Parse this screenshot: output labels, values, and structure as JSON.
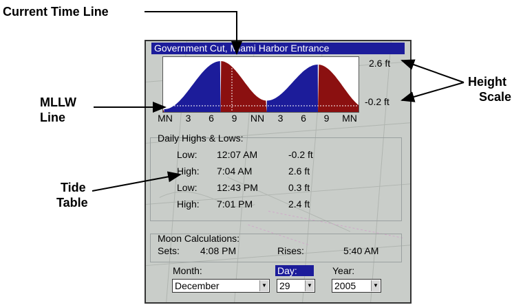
{
  "callouts": {
    "current_time_line": "Current Time Line",
    "mllw_line_1": "MLLW",
    "mllw_line_2": "Line",
    "tide_table_1": "Tide",
    "tide_table_2": "Table",
    "height_scale_1": "Height",
    "height_scale_2": "Scale"
  },
  "title": "Government Cut, Miami Harbor Entrance",
  "graph": {
    "scale_top": "2.6 ft",
    "scale_bottom": "-0.2 ft",
    "x_ticks": [
      "MN",
      "3",
      "6",
      "9",
      "NN",
      "3",
      "6",
      "9",
      "MN"
    ]
  },
  "highs_lows": {
    "title": "Daily Highs & Lows:",
    "rows": [
      {
        "type": "Low:",
        "time": "12:07 AM",
        "height": "-0.2 ft"
      },
      {
        "type": "High:",
        "time": "7:04 AM",
        "height": "2.6 ft"
      },
      {
        "type": "Low:",
        "time": "12:43 PM",
        "height": "0.3 ft"
      },
      {
        "type": "High:",
        "time": "7:01 PM",
        "height": "2.4 ft"
      }
    ]
  },
  "moon": {
    "title": "Moon Calculations:",
    "sets_label": "Sets:",
    "sets_time": "4:08 PM",
    "rises_label": "Rises:",
    "rises_time": "5:40 AM"
  },
  "date": {
    "month_label": "Month:",
    "month_value": "December",
    "day_label": "Day:",
    "day_value": "29",
    "year_label": "Year:",
    "year_value": "2005"
  },
  "colors": {
    "rising": "#1c1c9a",
    "falling": "#8b1010",
    "title_bar": "#1c1c9a"
  }
}
